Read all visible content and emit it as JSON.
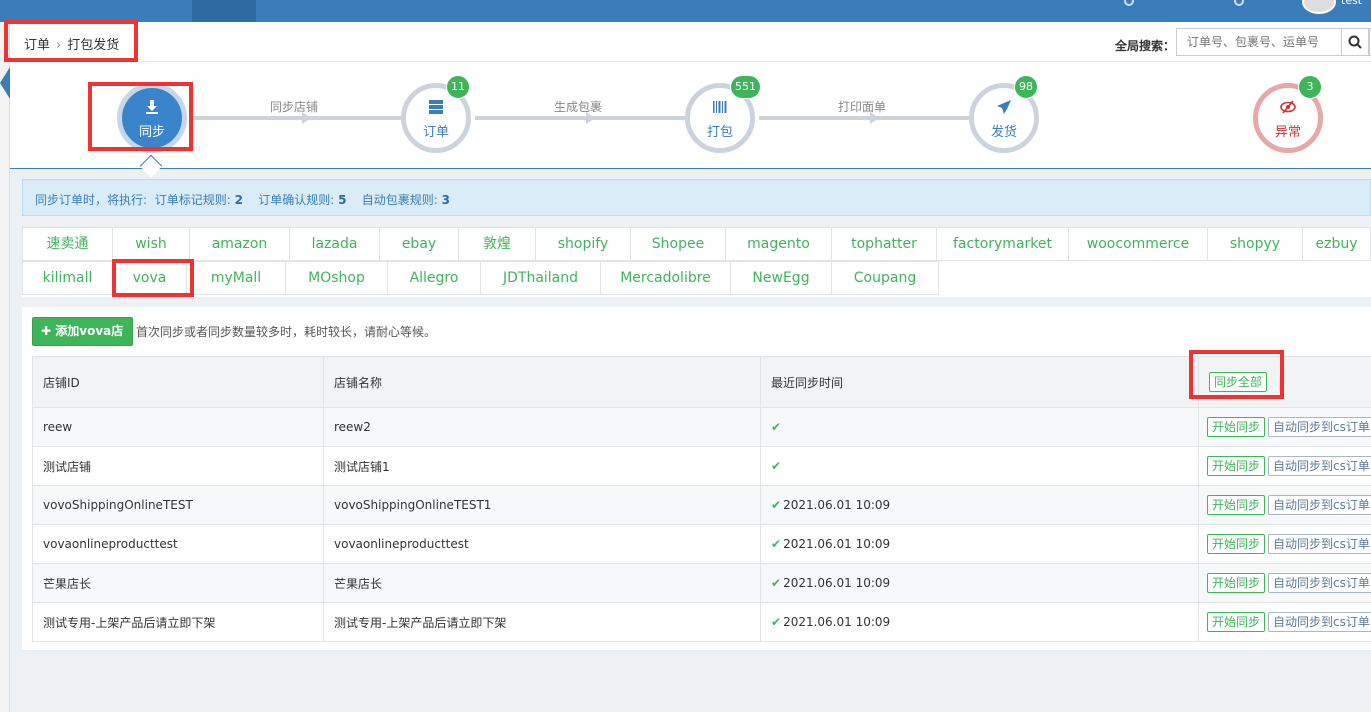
{
  "breadcrumb": {
    "root": "订单",
    "current": "打包发货"
  },
  "global_search": {
    "label": "全局搜索：",
    "placeholder": "订单号、包裹号、运单号"
  },
  "user": {
    "name": "test"
  },
  "steps": [
    {
      "label": "同步",
      "badge": null,
      "state": "active"
    },
    {
      "label": "订单",
      "badge": "11",
      "state": "normal"
    },
    {
      "label": "打包",
      "badge": "551",
      "state": "normal"
    },
    {
      "label": "发货",
      "badge": "98",
      "state": "normal"
    },
    {
      "label": "异常",
      "badge": "3",
      "state": "warn"
    }
  ],
  "connectors": [
    "同步店铺",
    "生成包裹",
    "打印面单"
  ],
  "rules": {
    "prefix": "同步订单时，将执行:",
    "items": [
      {
        "label": "订单标记规则:",
        "count": "2"
      },
      {
        "label": "订单确认规则:",
        "count": "5"
      },
      {
        "label": "自动包裹规则:",
        "count": "3"
      }
    ]
  },
  "platforms_row1": [
    "速卖通",
    "wish",
    "amazon",
    "lazada",
    "ebay",
    "敦煌",
    "shopify",
    "Shopee",
    "magento",
    "tophatter",
    "factorymarket",
    "woocommerce",
    "shopyy",
    "ezbuy"
  ],
  "platforms_row2": [
    "kilimall",
    "vova",
    "myMall",
    "MOshop",
    "Allegro",
    "JDThailand",
    "Mercadolibre",
    "NewEgg",
    "Coupang"
  ],
  "active_platform": "vova",
  "toolbar": {
    "add_label": "添加vova店铺",
    "hint": "首次同步或者同步数量较多时，耗时较长，请耐心等候。"
  },
  "table": {
    "headers": [
      "店铺ID",
      "店铺名称",
      "最近同步时间"
    ],
    "sync_all_label": "同步全部",
    "start_label": "开始同步",
    "auto_label": "自动同步到cs订单",
    "rows": [
      {
        "id": "reew",
        "name": "reew2",
        "time": ""
      },
      {
        "id": "测试店铺",
        "name": "测试店铺1",
        "time": ""
      },
      {
        "id": "vovoShippingOnlineTEST",
        "name": "vovoShippingOnlineTEST1",
        "time": "2021.06.01 10:09"
      },
      {
        "id": "vovaonlineproducttest",
        "name": "vovaonlineproducttest",
        "time": "2021.06.01 10:09"
      },
      {
        "id": "芒果店长",
        "name": "芒果店长",
        "time": "2021.06.01 10:09"
      },
      {
        "id": "测试专用-上架产品后请立即下架",
        "name": "测试专用-上架产品后请立即下架",
        "time": "2021.06.01 10:09"
      }
    ]
  },
  "colors": {
    "brand_blue": "#3a7dba",
    "green": "#3fb55a",
    "highlight_red": "#ee3333",
    "warn_red": "#cc3333"
  }
}
